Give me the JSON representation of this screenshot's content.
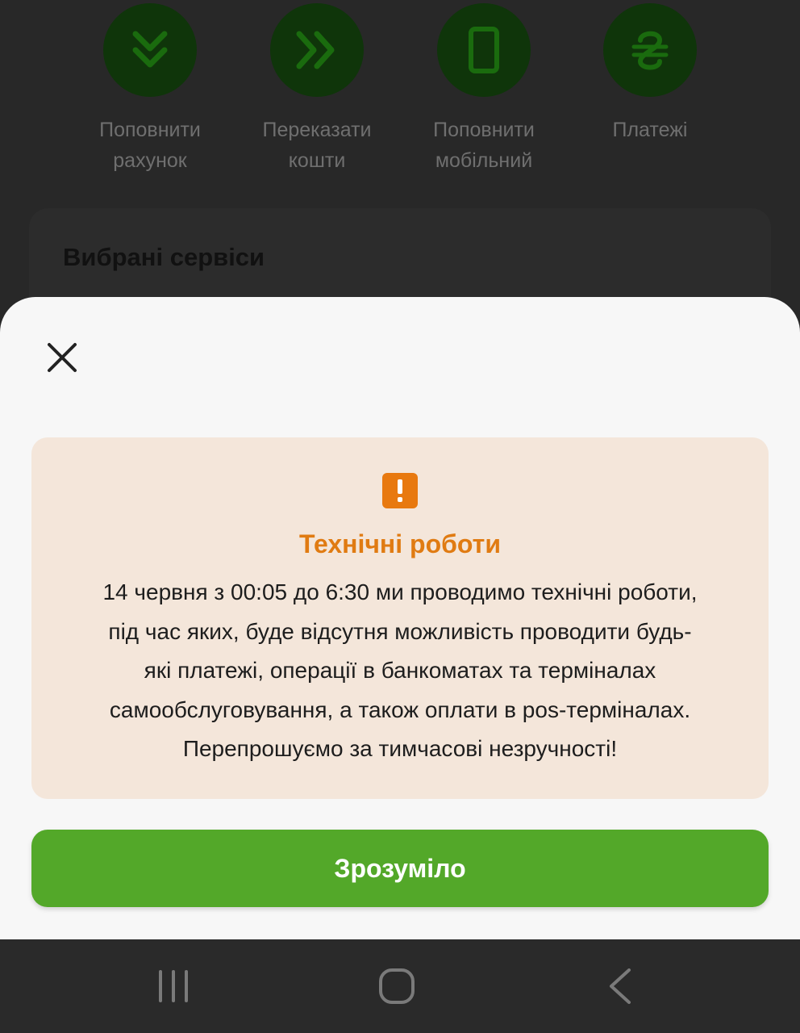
{
  "quick_actions": [
    {
      "label": "Поповнити\nрахунок",
      "icon": "double-chevron-down-icon"
    },
    {
      "label": "Переказати\nкошти",
      "icon": "double-chevron-right-icon"
    },
    {
      "label": "Поповнити\nмобільний",
      "icon": "phone-icon"
    },
    {
      "label": "Платежі",
      "icon": "hryvnia-icon"
    }
  ],
  "favorites": {
    "title": "Вибрані сервіси"
  },
  "modal": {
    "close_icon": "close-icon",
    "warning_icon": "warning-icon",
    "title": "Технічні роботи",
    "message": "14 червня з 00:05 до 6:30 ми проводимо технічні роботи,\nпід час яких, буде відсутня можливість проводити будь-\nякі платежі, операції в банкоматах та терміналах\nсамообслуговування, а також оплати в pos-терміналах.\nПерепрошуємо за  тимчасові незручності!",
    "confirm_label": "Зрозуміло"
  },
  "colors": {
    "accent_green": "#53a829",
    "warning_orange": "#e8790f",
    "notice_bg": "#f4e6da"
  },
  "navbar": [
    {
      "icon": "recent-apps-icon"
    },
    {
      "icon": "home-icon"
    },
    {
      "icon": "back-icon"
    }
  ]
}
